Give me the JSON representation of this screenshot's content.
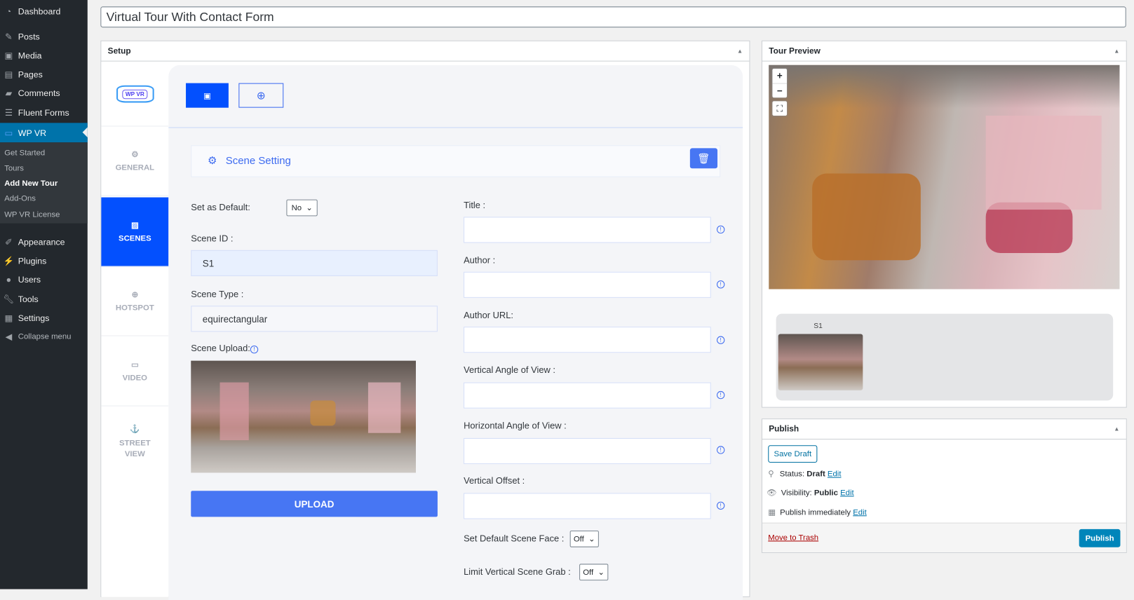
{
  "sidebar": {
    "items": [
      {
        "label": "Dashboard",
        "icon": "dashboard-icon"
      },
      {
        "label": "Posts",
        "icon": "pin-icon"
      },
      {
        "label": "Media",
        "icon": "media-icon"
      },
      {
        "label": "Pages",
        "icon": "pages-icon"
      },
      {
        "label": "Comments",
        "icon": "comment-icon"
      },
      {
        "label": "Fluent Forms",
        "icon": "form-icon"
      },
      {
        "label": "WP VR",
        "icon": "vr-headset-icon"
      },
      {
        "label": "Appearance",
        "icon": "paintbrush-icon"
      },
      {
        "label": "Plugins",
        "icon": "plugin-icon"
      },
      {
        "label": "Users",
        "icon": "user-icon"
      },
      {
        "label": "Tools",
        "icon": "wrench-icon"
      },
      {
        "label": "Settings",
        "icon": "settings-icon"
      },
      {
        "label": "Collapse menu",
        "icon": "collapse-icon"
      }
    ],
    "submenu": [
      "Get Started",
      "Tours",
      "Add New Tour",
      "Add-Ons",
      "WP VR License"
    ]
  },
  "title": "Virtual Tour With Contact Form",
  "setup": {
    "heading": "Setup",
    "logo": "WP VR",
    "tabs": [
      "GENERAL",
      "SCENES",
      "HOTSPOT",
      "VIDEO",
      "STREET VIEW"
    ],
    "scene_setting": "Scene Setting",
    "default_label": "Set as Default:",
    "default_value": "No",
    "scene_id_label": "Scene ID :",
    "scene_id": "S1",
    "scene_type_label": "Scene Type :",
    "scene_type": "equirectangular",
    "scene_upload_label": "Scene Upload:",
    "upload_button": "UPLOAD",
    "fields": [
      "Title :",
      "Author :",
      "Author URL:",
      "Vertical Angle of View :",
      "Horizontal Angle of View :",
      "Vertical Offset :"
    ],
    "default_face_label": "Set Default Scene Face :",
    "default_face_value": "Off",
    "limit_grab_label": "Limit Vertical Scene Grab :",
    "limit_grab_value": "Off"
  },
  "preview": {
    "heading": "Tour Preview",
    "zoom_in": "+",
    "zoom_out": "−",
    "scene_thumb_label": "S1"
  },
  "publish": {
    "heading": "Publish",
    "save_draft": "Save Draft",
    "status_label": "Status:",
    "status": "Draft",
    "visibility_label": "Visibility:",
    "visibility": "Public",
    "schedule": "Publish immediately",
    "edit": "Edit",
    "trash": "Move to Trash",
    "publish_button": "Publish"
  },
  "colors": {
    "accent": "#0350fe",
    "upload": "#4776f3",
    "wp_blue": "#0073aa",
    "sidebar": "#23282d"
  }
}
